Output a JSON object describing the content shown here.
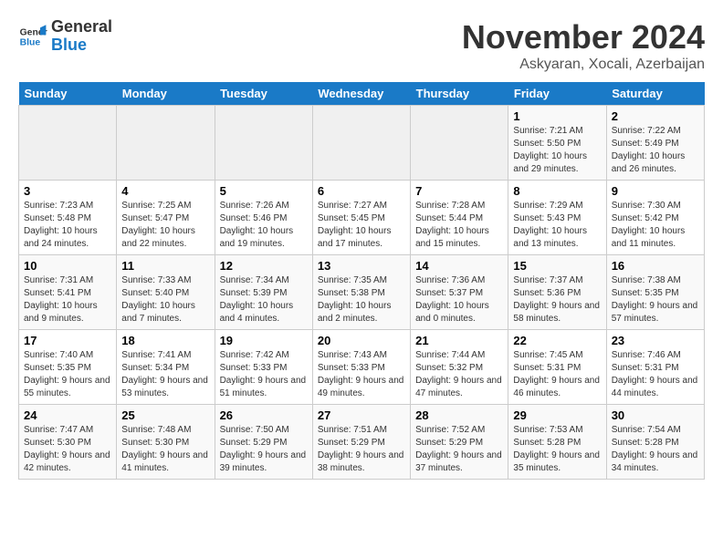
{
  "header": {
    "logo_line1": "General",
    "logo_line2": "Blue",
    "month_title": "November 2024",
    "location": "Askyaran, Xocali, Azerbaijan"
  },
  "days_of_week": [
    "Sunday",
    "Monday",
    "Tuesday",
    "Wednesday",
    "Thursday",
    "Friday",
    "Saturday"
  ],
  "weeks": [
    [
      {
        "day": "",
        "info": ""
      },
      {
        "day": "",
        "info": ""
      },
      {
        "day": "",
        "info": ""
      },
      {
        "day": "",
        "info": ""
      },
      {
        "day": "",
        "info": ""
      },
      {
        "day": "1",
        "info": "Sunrise: 7:21 AM\nSunset: 5:50 PM\nDaylight: 10 hours and 29 minutes."
      },
      {
        "day": "2",
        "info": "Sunrise: 7:22 AM\nSunset: 5:49 PM\nDaylight: 10 hours and 26 minutes."
      }
    ],
    [
      {
        "day": "3",
        "info": "Sunrise: 7:23 AM\nSunset: 5:48 PM\nDaylight: 10 hours and 24 minutes."
      },
      {
        "day": "4",
        "info": "Sunrise: 7:25 AM\nSunset: 5:47 PM\nDaylight: 10 hours and 22 minutes."
      },
      {
        "day": "5",
        "info": "Sunrise: 7:26 AM\nSunset: 5:46 PM\nDaylight: 10 hours and 19 minutes."
      },
      {
        "day": "6",
        "info": "Sunrise: 7:27 AM\nSunset: 5:45 PM\nDaylight: 10 hours and 17 minutes."
      },
      {
        "day": "7",
        "info": "Sunrise: 7:28 AM\nSunset: 5:44 PM\nDaylight: 10 hours and 15 minutes."
      },
      {
        "day": "8",
        "info": "Sunrise: 7:29 AM\nSunset: 5:43 PM\nDaylight: 10 hours and 13 minutes."
      },
      {
        "day": "9",
        "info": "Sunrise: 7:30 AM\nSunset: 5:42 PM\nDaylight: 10 hours and 11 minutes."
      }
    ],
    [
      {
        "day": "10",
        "info": "Sunrise: 7:31 AM\nSunset: 5:41 PM\nDaylight: 10 hours and 9 minutes."
      },
      {
        "day": "11",
        "info": "Sunrise: 7:33 AM\nSunset: 5:40 PM\nDaylight: 10 hours and 7 minutes."
      },
      {
        "day": "12",
        "info": "Sunrise: 7:34 AM\nSunset: 5:39 PM\nDaylight: 10 hours and 4 minutes."
      },
      {
        "day": "13",
        "info": "Sunrise: 7:35 AM\nSunset: 5:38 PM\nDaylight: 10 hours and 2 minutes."
      },
      {
        "day": "14",
        "info": "Sunrise: 7:36 AM\nSunset: 5:37 PM\nDaylight: 10 hours and 0 minutes."
      },
      {
        "day": "15",
        "info": "Sunrise: 7:37 AM\nSunset: 5:36 PM\nDaylight: 9 hours and 58 minutes."
      },
      {
        "day": "16",
        "info": "Sunrise: 7:38 AM\nSunset: 5:35 PM\nDaylight: 9 hours and 57 minutes."
      }
    ],
    [
      {
        "day": "17",
        "info": "Sunrise: 7:40 AM\nSunset: 5:35 PM\nDaylight: 9 hours and 55 minutes."
      },
      {
        "day": "18",
        "info": "Sunrise: 7:41 AM\nSunset: 5:34 PM\nDaylight: 9 hours and 53 minutes."
      },
      {
        "day": "19",
        "info": "Sunrise: 7:42 AM\nSunset: 5:33 PM\nDaylight: 9 hours and 51 minutes."
      },
      {
        "day": "20",
        "info": "Sunrise: 7:43 AM\nSunset: 5:33 PM\nDaylight: 9 hours and 49 minutes."
      },
      {
        "day": "21",
        "info": "Sunrise: 7:44 AM\nSunset: 5:32 PM\nDaylight: 9 hours and 47 minutes."
      },
      {
        "day": "22",
        "info": "Sunrise: 7:45 AM\nSunset: 5:31 PM\nDaylight: 9 hours and 46 minutes."
      },
      {
        "day": "23",
        "info": "Sunrise: 7:46 AM\nSunset: 5:31 PM\nDaylight: 9 hours and 44 minutes."
      }
    ],
    [
      {
        "day": "24",
        "info": "Sunrise: 7:47 AM\nSunset: 5:30 PM\nDaylight: 9 hours and 42 minutes."
      },
      {
        "day": "25",
        "info": "Sunrise: 7:48 AM\nSunset: 5:30 PM\nDaylight: 9 hours and 41 minutes."
      },
      {
        "day": "26",
        "info": "Sunrise: 7:50 AM\nSunset: 5:29 PM\nDaylight: 9 hours and 39 minutes."
      },
      {
        "day": "27",
        "info": "Sunrise: 7:51 AM\nSunset: 5:29 PM\nDaylight: 9 hours and 38 minutes."
      },
      {
        "day": "28",
        "info": "Sunrise: 7:52 AM\nSunset: 5:29 PM\nDaylight: 9 hours and 37 minutes."
      },
      {
        "day": "29",
        "info": "Sunrise: 7:53 AM\nSunset: 5:28 PM\nDaylight: 9 hours and 35 minutes."
      },
      {
        "day": "30",
        "info": "Sunrise: 7:54 AM\nSunset: 5:28 PM\nDaylight: 9 hours and 34 minutes."
      }
    ]
  ]
}
